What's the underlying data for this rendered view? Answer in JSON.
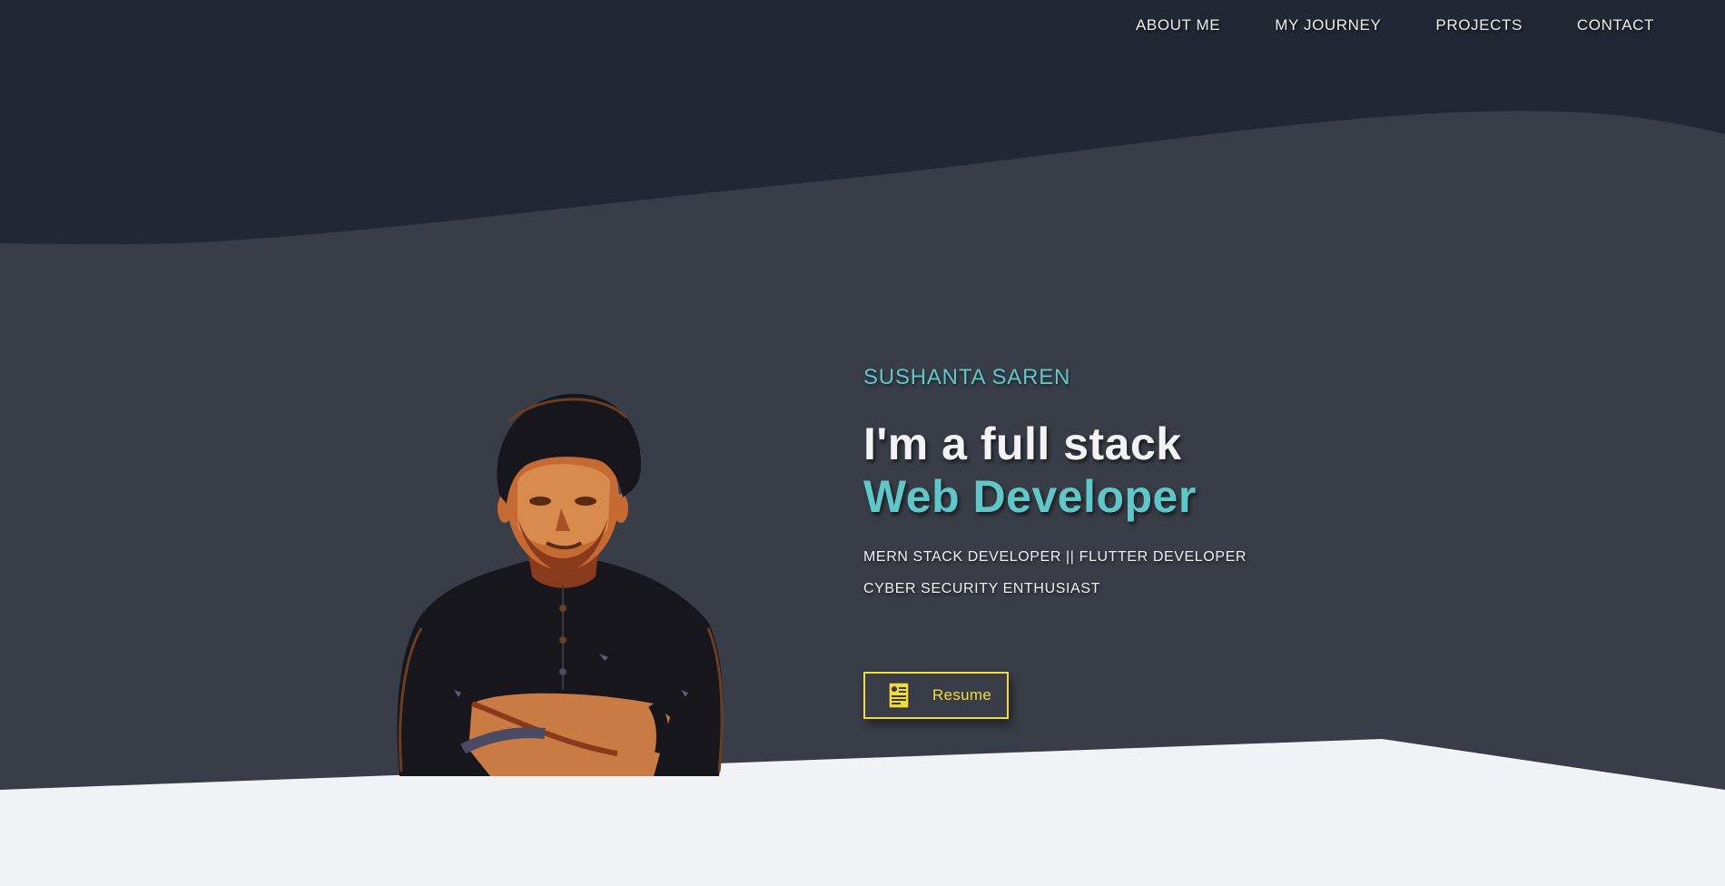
{
  "nav": {
    "items": [
      {
        "label": "ABOUT ME"
      },
      {
        "label": "MY JOURNEY"
      },
      {
        "label": "PROJECTS"
      },
      {
        "label": "CONTACT"
      }
    ]
  },
  "hero": {
    "name": "SUSHANTA SAREN",
    "headline_line1": "I'm a full stack",
    "headline_line2": "Web Developer",
    "subtitle_line1": "MERN STACK DEVELOPER || FLUTTER DEVELOPER",
    "subtitle_line2": "CYBER SECURITY ENTHUSIAST",
    "resume_label": "Resume"
  },
  "colors": {
    "top_band": "#222833",
    "hero_bg": "#393d47",
    "bottom_bg": "#f1f2f5",
    "accent_teal": "#5fc7c8",
    "accent_yellow": "#f2dc3c"
  },
  "icons": {
    "resume": "resume-document-icon"
  }
}
